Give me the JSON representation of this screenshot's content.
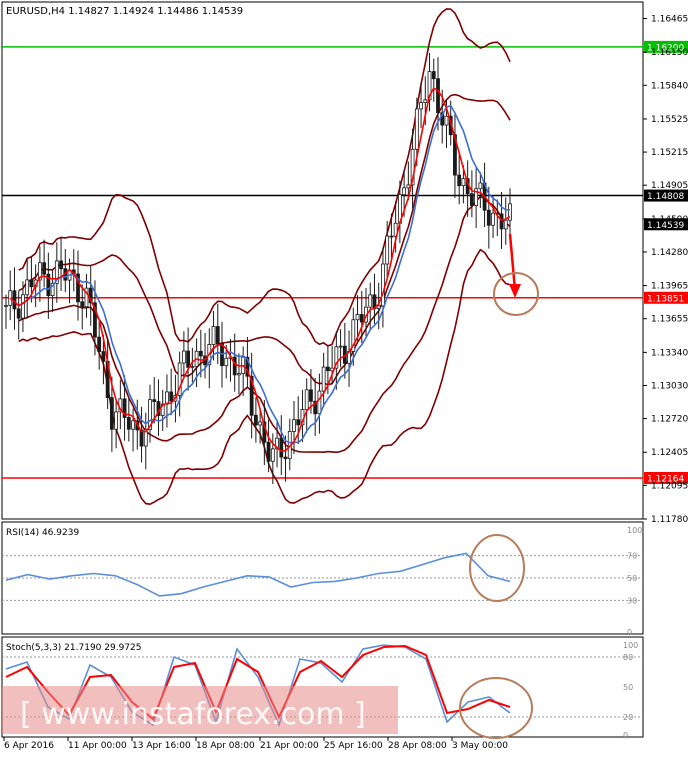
{
  "chart_data": {
    "type": "candlestick",
    "symbol_line": "EURUSD,H4  1.14827 1.14924 1.14486 1.14539",
    "price_ticks": [
      "1.16465",
      "1.16150",
      "1.15840",
      "1.15525",
      "1.15215",
      "1.14905",
      "1.14590",
      "1.14280",
      "1.13965",
      "1.13655",
      "1.13340",
      "1.13030",
      "1.12720",
      "1.12405",
      "1.12095",
      "1.11780"
    ],
    "price_range": [
      1.1178,
      1.1662
    ],
    "levels": [
      {
        "label": "1.16200",
        "value": 1.162,
        "color": "#00c000"
      },
      {
        "label": "1.14808",
        "value": 1.14808,
        "color": "#000000"
      },
      {
        "label": "1.14539",
        "value": 1.14539,
        "color": "#000000"
      },
      {
        "label": "1.13851",
        "value": 1.13851,
        "color": "#ff0000"
      },
      {
        "label": "1.12164",
        "value": 1.12164,
        "color": "#ff0000"
      }
    ],
    "x_ticks": [
      "6 Apr 2016",
      "11 Apr 00:00",
      "13 Apr 16:00",
      "18 Apr 08:00",
      "21 Apr 00:00",
      "25 Apr 16:00",
      "28 Apr 08:00",
      "3 May 00:00"
    ],
    "key_closes": [
      1.137,
      1.14,
      1.141,
      1.139,
      1.128,
      1.126,
      1.129,
      1.133,
      1.134,
      1.131,
      1.123,
      1.127,
      1.131,
      1.135,
      1.139,
      1.149,
      1.16,
      1.15,
      1.147,
      1.1454
    ],
    "rsi": {
      "label": "RSI(14) 46.9239",
      "levels": [
        70,
        50,
        30
      ],
      "ticks": [
        "100",
        "70",
        "50",
        "30",
        "0"
      ],
      "values": [
        48,
        53,
        49,
        52,
        54,
        52,
        44,
        34,
        36,
        42,
        47,
        52,
        51,
        42,
        46,
        47,
        50,
        54,
        56,
        62,
        68,
        72,
        52,
        47
      ]
    },
    "stoch": {
      "label": "Stoch(5,3,3) 21.7190 29.9725",
      "levels": [
        80,
        20
      ],
      "ticks": [
        "100",
        "80",
        "50",
        "20",
        "0"
      ],
      "main": [
        68,
        75,
        30,
        18,
        72,
        60,
        25,
        12,
        80,
        72,
        15,
        88,
        60,
        12,
        78,
        74,
        55,
        88,
        92,
        90,
        78,
        15,
        35,
        40,
        24
      ],
      "signal": [
        60,
        70,
        45,
        22,
        60,
        62,
        35,
        18,
        70,
        74,
        25,
        78,
        65,
        20,
        65,
        76,
        60,
        82,
        90,
        91,
        82,
        24,
        28,
        37,
        30
      ]
    },
    "colors": {
      "bollinger": "#7f0000",
      "ma_fast": "#ff0000",
      "ma_slow": "#3b6fd4",
      "rsi": "#5b8fd9",
      "annotation": "#b87c5a"
    }
  },
  "watermark": "[ www.instaforex.com ]"
}
